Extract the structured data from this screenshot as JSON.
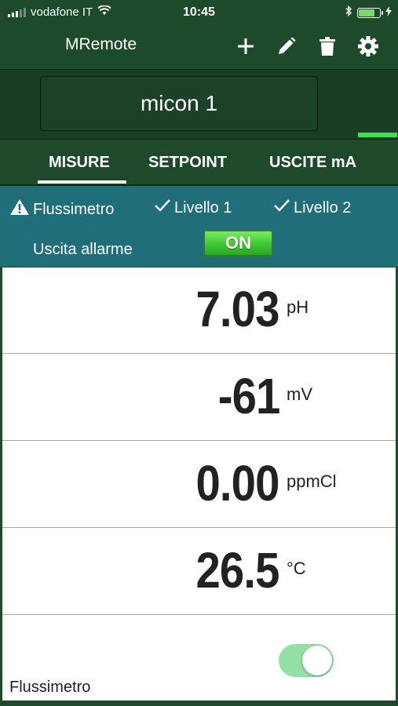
{
  "status": {
    "carrier": "vodafone IT",
    "time": "10:45"
  },
  "nav": {
    "title": "MRemote",
    "icons": [
      "plus-icon",
      "pencil-icon",
      "trash-icon",
      "gear-icon"
    ]
  },
  "device": {
    "name": "micon 1"
  },
  "tabs": [
    {
      "label": "MISURE",
      "active": true
    },
    {
      "label": "SETPOINT",
      "active": false
    },
    {
      "label": "USCITE mA",
      "active": false
    }
  ],
  "alarms": {
    "flussimetro": "Flussimetro",
    "livello1": "Livello 1",
    "livello2": "Livello 2",
    "uscita_label": "Uscita allarme",
    "uscita_state": "ON"
  },
  "readings": [
    {
      "value": "7.03",
      "unit": "pH"
    },
    {
      "value": "-61",
      "unit": "mV"
    },
    {
      "value": "0.00",
      "unit": "ppmCl"
    },
    {
      "value": "26.5",
      "unit": "°C"
    }
  ],
  "flow": {
    "label": "Flussimetro",
    "enabled": true
  },
  "colors": {
    "header": "#1c4a2a",
    "alarm_bar": "#206e7a",
    "indicator": "#3ee04f",
    "switch_on": "#93e0a6"
  }
}
